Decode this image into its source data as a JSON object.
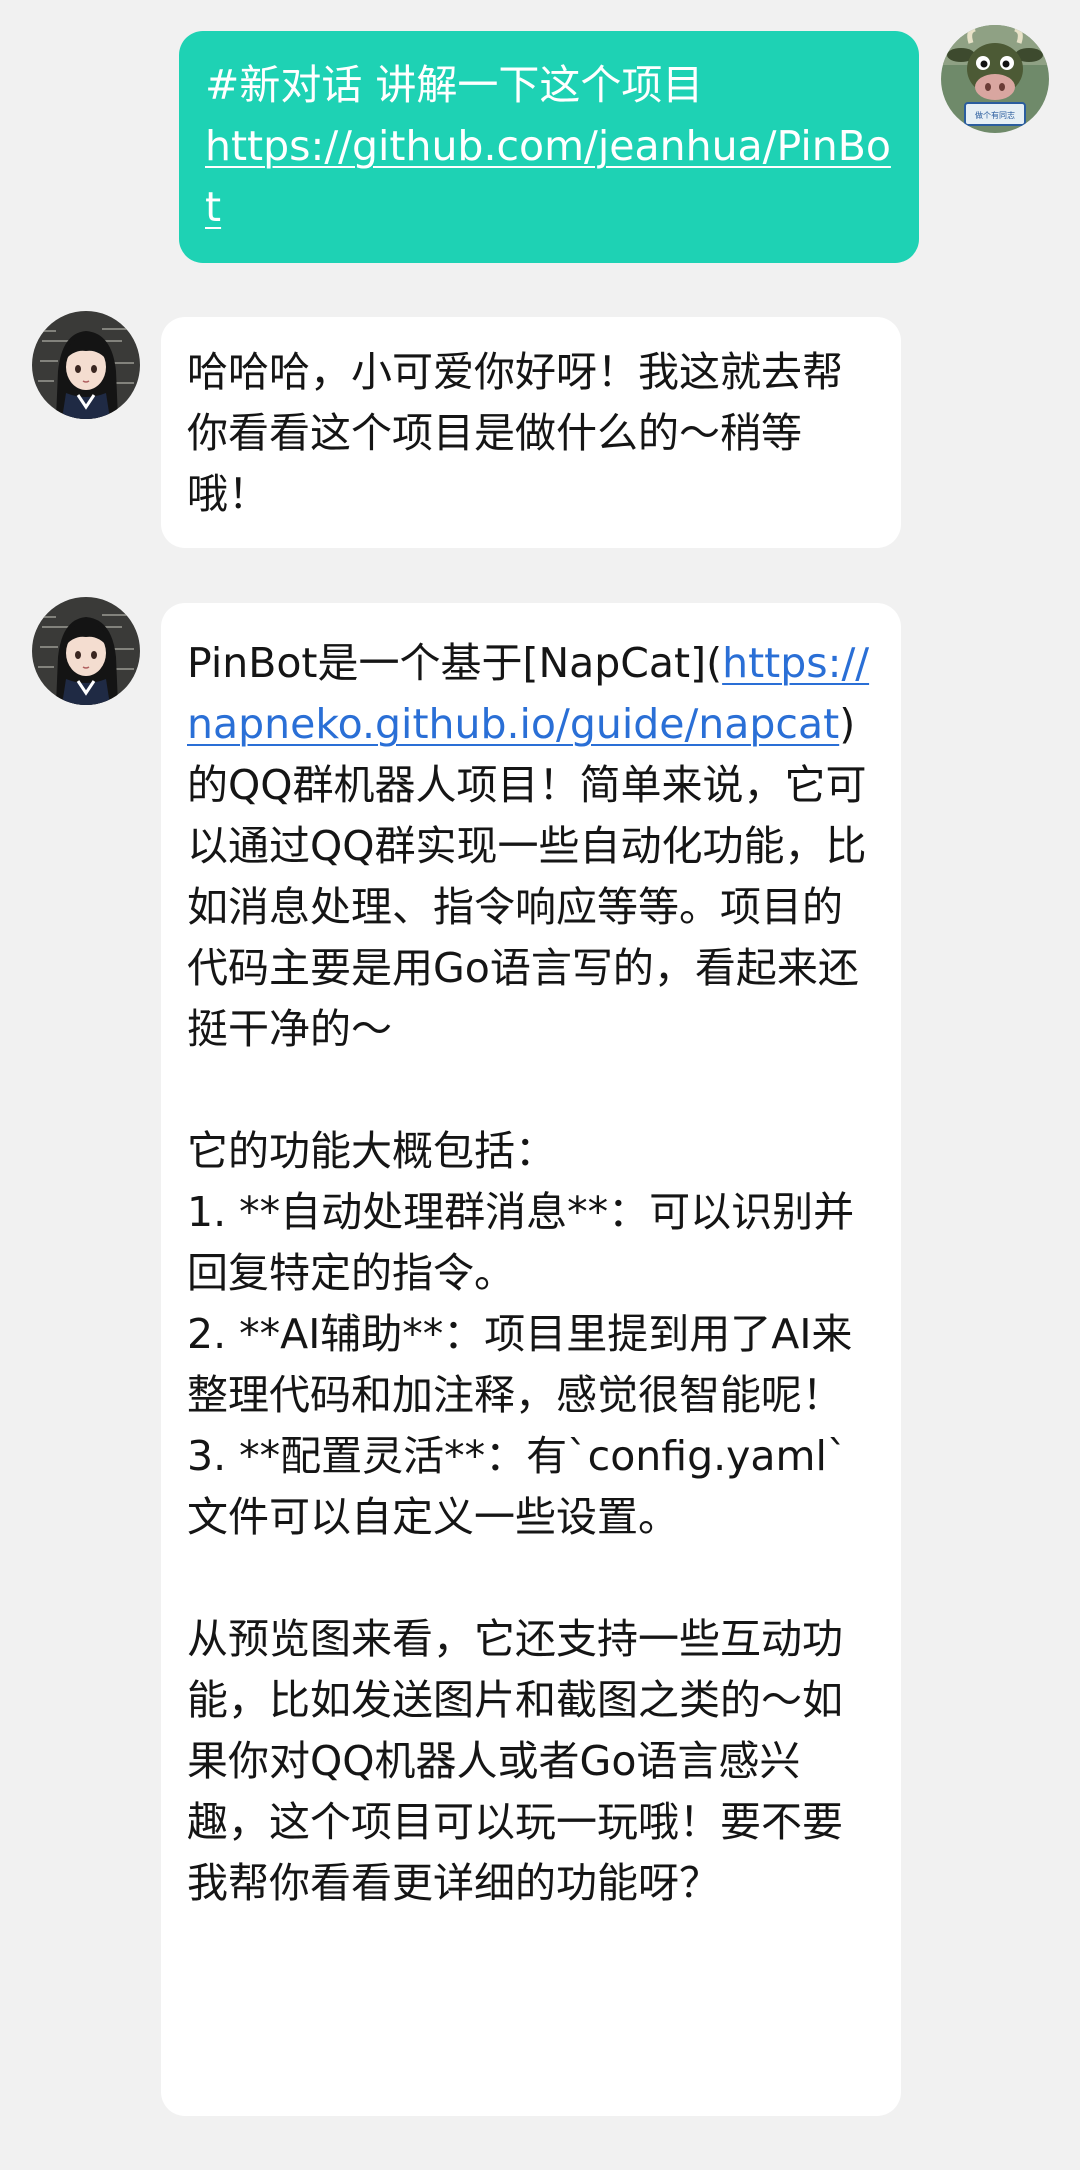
{
  "conversation": {
    "messages": [
      {
        "sender": "user",
        "text": "#新对话 讲解一下这个项目\n",
        "link": "https://github.com/jeanhua/PinBot",
        "avatar": "cow-avatar-icon",
        "bubble_color": "#1ed2b4"
      },
      {
        "sender": "bot",
        "text": "哈哈哈，小可爱你好呀！我这就去帮你看看这个项目是做什么的～稍等哦！",
        "avatar": "anime-girl-avatar-icon",
        "bubble_color": "#ffffff"
      },
      {
        "sender": "bot",
        "text_before": "PinBot是一个基于[NapCat](",
        "link": "https://napneko.github.io/guide/napcat",
        "text_after": ")的QQ群机器人项目！简单来说，它可以通过QQ群实现一些自动化功能，比如消息处理、指令响应等等。项目的代码主要是用Go语言写的，看起来还挺干净的～\n\n它的功能大概包括：\n1. **自动处理群消息**：可以识别并回复特定的指令。\n2. **AI辅助**：项目里提到用了AI来整理代码和加注释，感觉很智能呢！\n3. **配置灵活**：有`config.yaml`文件可以自定义一些设置。\n\n从预览图来看，它还支持一些互动功能，比如发送图片和截图之类的～如果你对QQ机器人或者Go语言感兴趣，这个项目可以玩一玩哦！要不要我帮你看看更详细的功能呀？",
        "avatar": "anime-girl-avatar-icon",
        "bubble_color": "#ffffff",
        "link_color": "#2a6fd6"
      }
    ],
    "user_avatar_sign": "做个有同志"
  }
}
